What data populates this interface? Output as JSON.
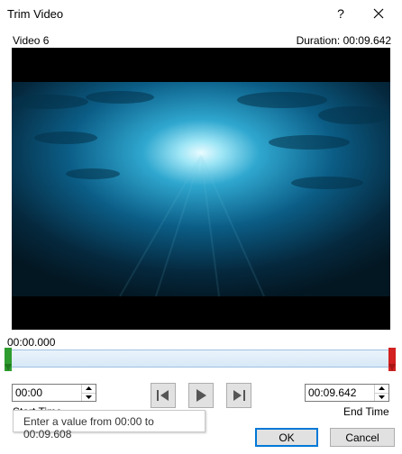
{
  "window": {
    "title": "Trim Video",
    "help_glyph": "?"
  },
  "video": {
    "name": "Video 6",
    "duration": "Duration: 00:09.642"
  },
  "timeline": {
    "current_position": "00:00.000",
    "start_fraction": 0,
    "end_fraction": 1,
    "colors": {
      "start_marker": "#2e9c2e",
      "end_marker": "#d32020",
      "track": "#d7e8f7"
    }
  },
  "start_time": {
    "value": "00:00",
    "label": "Start Time"
  },
  "end_time": {
    "value": "00:09.642",
    "label": "End Time"
  },
  "controls": {
    "prev_icon": "previous-frame-icon",
    "play_icon": "play-icon",
    "next_icon": "next-frame-icon"
  },
  "tooltip": {
    "text": "Enter a value from 00:00 to 00:09.608"
  },
  "buttons": {
    "ok": "OK",
    "cancel": "Cancel"
  },
  "accent": "#0078d7"
}
